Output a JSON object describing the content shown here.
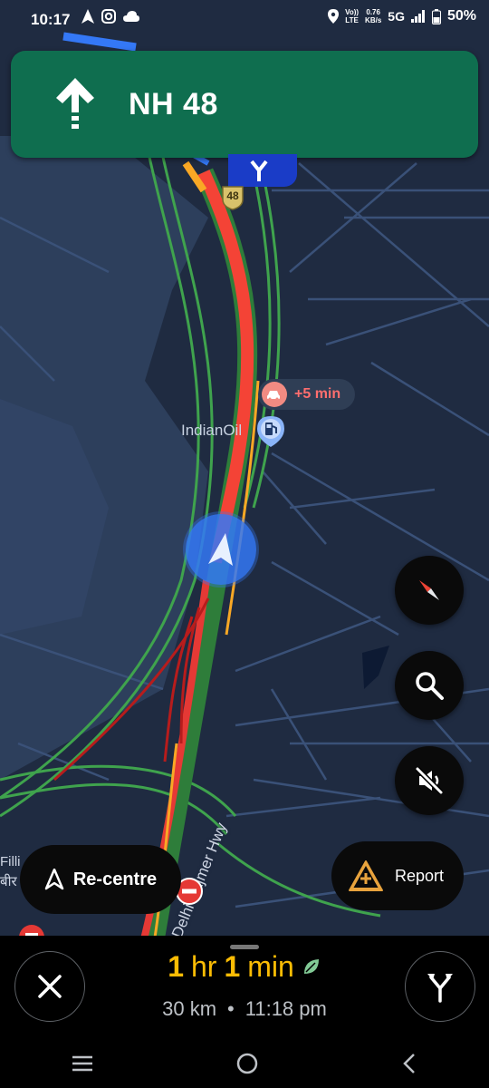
{
  "status_bar": {
    "time": "10:17",
    "volte_top": "Vo))",
    "volte_bottom": "LTE",
    "speed_top": "0.76",
    "speed_bottom": "KB/s",
    "network": "5G",
    "battery": "50%",
    "icons": [
      "navigation-arrow-icon",
      "instagram-icon",
      "cloud-icon",
      "location-icon",
      "signal-icon",
      "battery-icon"
    ]
  },
  "nav_banner": {
    "road": "NH 48",
    "maneuver_icon": "straight-arrow-icon",
    "color": "#0f6e4f"
  },
  "map": {
    "highway_shield": "48",
    "poi_name": "IndianOil",
    "poi_icon": "fuel-pump-icon",
    "delay_text": "+5 min",
    "delay_icon": "car-crash-icon",
    "street_name": "Delhi - Ajmer Hwy",
    "place_label_1": "Filli",
    "place_label_2": "बीर",
    "traffic_colors": {
      "heavy": "#f44336",
      "slow": "#f9a825",
      "free": "#3fa34d"
    }
  },
  "buttons": {
    "recentre_label": "Re-centre",
    "report_label": "Report",
    "compass_icon": "compass-icon",
    "search_icon": "search-icon",
    "mute_icon": "sound-off-icon"
  },
  "trip": {
    "eta_hours_num": "1",
    "eta_hours_unit": "hr",
    "eta_min_num": "1",
    "eta_min_unit": "min",
    "distance": "30 km",
    "separator": "•",
    "arrival": "11:18 pm",
    "eta_color": "#fbbc04"
  },
  "system_nav": [
    "recents-icon",
    "home-icon",
    "back-icon"
  ]
}
